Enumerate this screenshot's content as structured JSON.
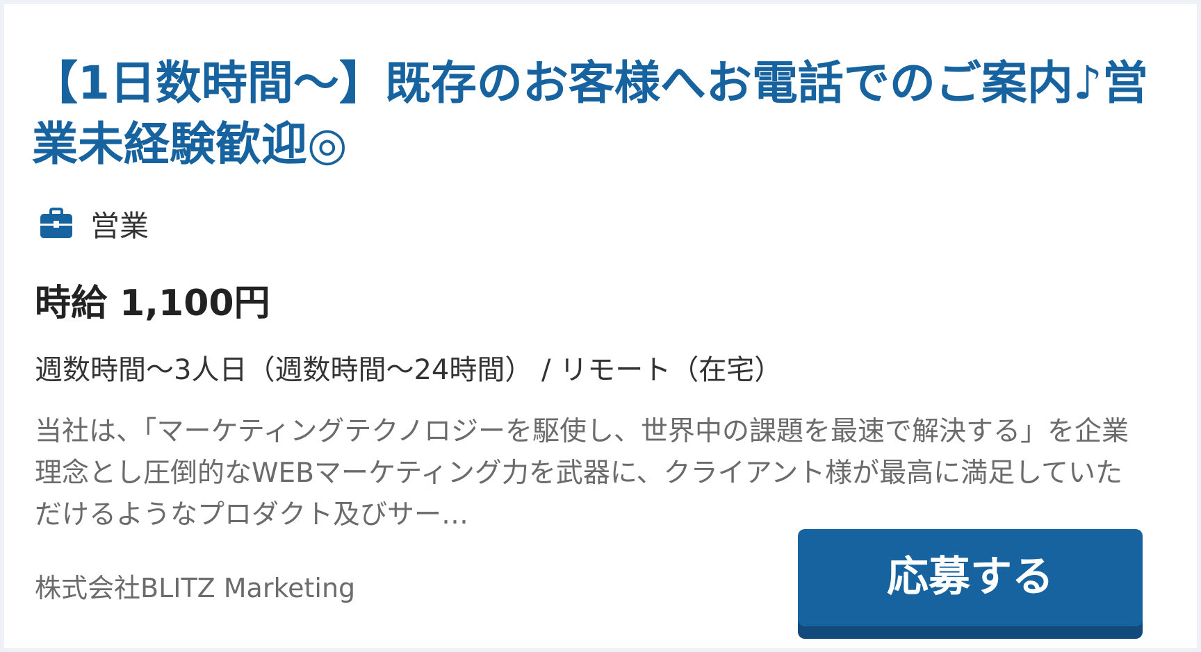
{
  "job": {
    "title": "【1日数時間～】既存のお客様へお電話でのご案内♪営業未経験歓迎◎",
    "category": {
      "icon": "briefcase-icon",
      "label": "営業"
    },
    "wage": "時給 1,100円",
    "schedule": "週数時間～3人日（週数時間～24時間） / リモート（在宅）",
    "description": "当社は、「マーケティングテクノロジーを駆使し、世界中の課題を最速で解決する」を企業理念とし圧倒的なWEBマーケティング力を武器に、クライアント様が最高に満足していただけるようなプロダクト及びサー…",
    "company": "株式会社BLITZ Marketing",
    "apply_label": "応募する"
  },
  "colors": {
    "accent": "#1763a0",
    "accent_shadow": "#134a7c",
    "text_dark": "#222222",
    "text_muted": "#6b6b6b",
    "background": "#eef1f6"
  }
}
